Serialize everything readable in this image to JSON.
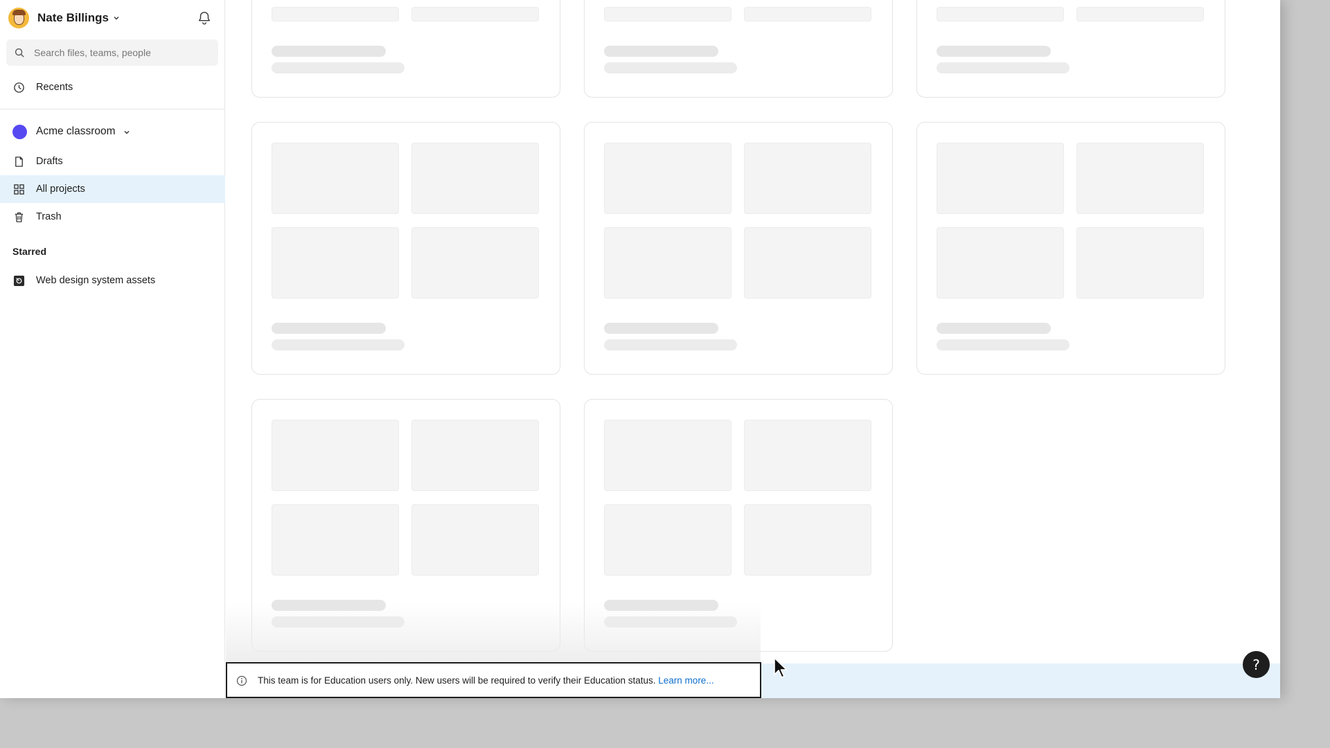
{
  "sidebar": {
    "user": {
      "name": "Nate Billings"
    },
    "search": {
      "placeholder": "Search files, teams, people"
    },
    "recents_label": "Recents",
    "team": {
      "name": "Acme classroom",
      "color": "#5749f2"
    },
    "items": [
      {
        "label": "Drafts",
        "icon": "file-icon"
      },
      {
        "label": "All projects",
        "icon": "grid-icon",
        "active": true
      },
      {
        "label": "Trash",
        "icon": "trash-icon"
      }
    ],
    "starred_heading": "Starred",
    "starred": [
      {
        "label": "Web design system assets",
        "icon": "figma-file-icon"
      }
    ]
  },
  "banner": {
    "message": "This team is for Education users only. New users will be required to verify their Education status.",
    "link": "Learn more..."
  },
  "help": {
    "label": "?"
  },
  "colors": {
    "accent": "#0d6ecc",
    "active_bg": "#e5f2fc",
    "team": "#5749f2"
  }
}
